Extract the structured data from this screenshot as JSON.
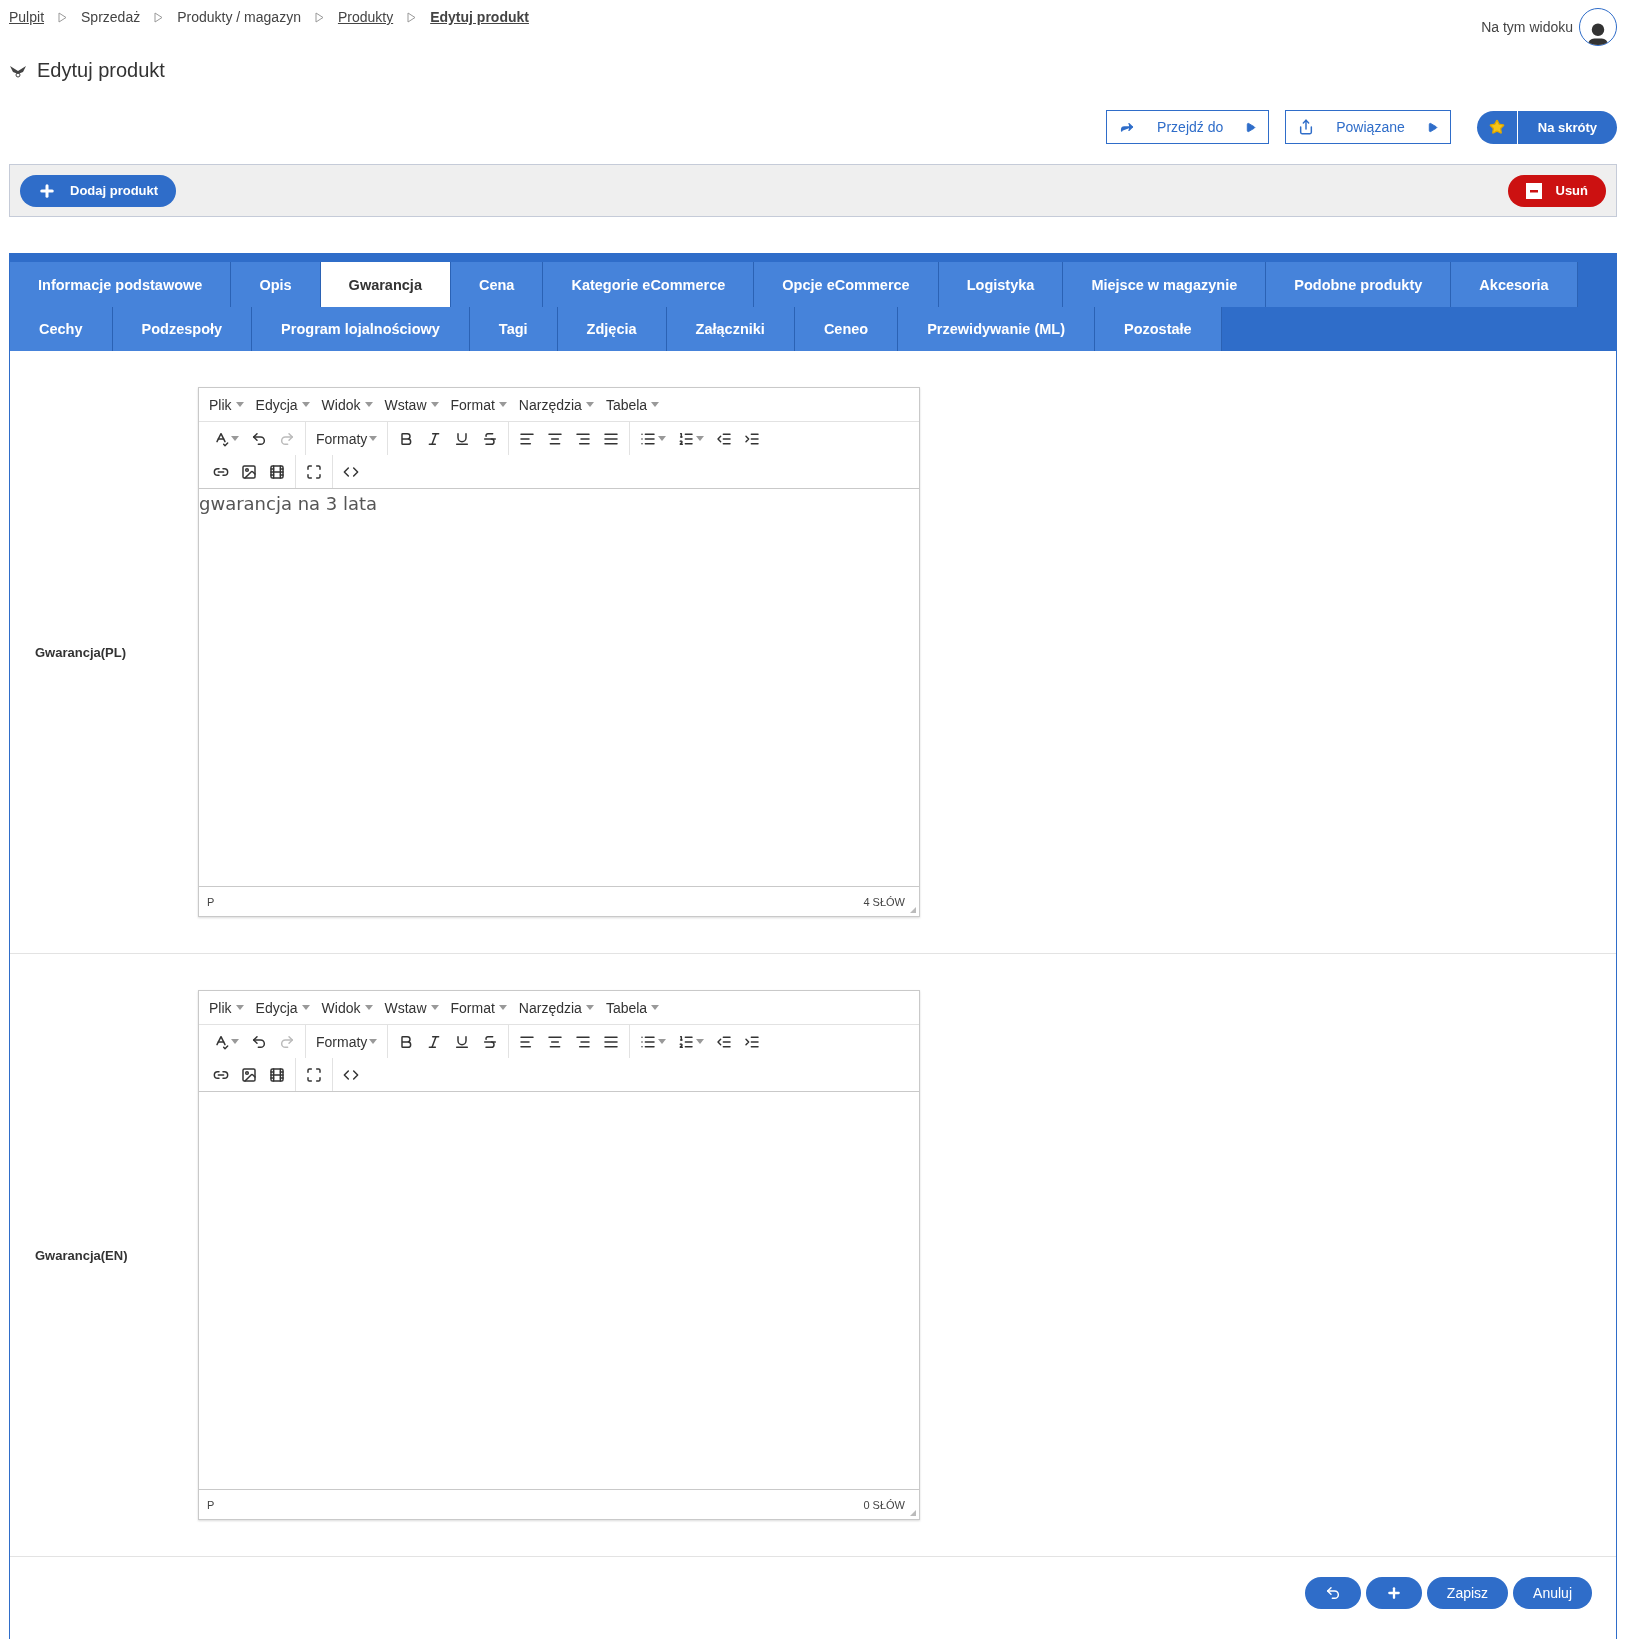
{
  "breadcrumbs": [
    {
      "label": "Pulpit",
      "kind": "link"
    },
    {
      "label": "Sprzedaż",
      "kind": "text"
    },
    {
      "label": "Produkty / magazyn",
      "kind": "text"
    },
    {
      "label": "Produkty",
      "kind": "link"
    },
    {
      "label": "Edytuj produkt",
      "kind": "current"
    }
  ],
  "view_label": "Na tym widoku",
  "title": "Edytuj produkt",
  "actions": [
    {
      "label": "Przejdź do",
      "kind": "goto"
    },
    {
      "label": "Powiązane",
      "kind": "related"
    }
  ],
  "shortcuts": {
    "label": "Na skróty"
  },
  "toolbar": {
    "add": "Dodaj produkt",
    "delete": "Usuń"
  },
  "tabs": [
    [
      {
        "label": "Informacje podstawowe",
        "selected": false
      },
      {
        "label": "Opis",
        "selected": false
      },
      {
        "label": "Gwarancja",
        "selected": true
      },
      {
        "label": "Cena",
        "selected": false
      },
      {
        "label": "Kategorie eCommerce",
        "selected": false
      },
      {
        "label": "Opcje eCommerce",
        "selected": false
      },
      {
        "label": "Logistyka",
        "selected": false
      },
      {
        "label": "Miejsce w magazynie",
        "selected": false
      },
      {
        "label": "Podobne produkty",
        "selected": false
      },
      {
        "label": "Akcesoria",
        "selected": false
      }
    ],
    [
      {
        "label": "Cechy",
        "selected": false
      },
      {
        "label": "Podzespoły",
        "selected": false
      },
      {
        "label": "Program lojalnościowy",
        "selected": false
      },
      {
        "label": "Tagi",
        "selected": false
      },
      {
        "label": "Zdjęcia",
        "selected": false
      },
      {
        "label": "Załączniki",
        "selected": false
      },
      {
        "label": "Ceneo",
        "selected": false
      },
      {
        "label": "Przewidywanie (ML)",
        "selected": false
      },
      {
        "label": "Pozostałe",
        "selected": false
      }
    ]
  ],
  "editors": [
    {
      "label": "Gwarancja(PL)",
      "menu": [
        "Plik",
        "Edycja",
        "Widok",
        "Wstaw",
        "Format",
        "Narzędzia",
        "Tabela"
      ],
      "formats": "Formaty",
      "content": "gwarancja na 3 lata",
      "path": "P",
      "word_count": "4 SŁÓW"
    },
    {
      "label": "Gwarancja(EN)",
      "menu": [
        "Plik",
        "Edycja",
        "Widok",
        "Wstaw",
        "Format",
        "Narzędzia",
        "Tabela"
      ],
      "formats": "Formaty",
      "path": "P",
      "word_count": "0 SŁÓW"
    }
  ],
  "footer_buttons": [
    {
      "kind": "restore"
    },
    {
      "kind": "add"
    },
    {
      "kind": "text",
      "label": "Zapisz"
    },
    {
      "kind": "text",
      "label": "Anuluj"
    }
  ]
}
